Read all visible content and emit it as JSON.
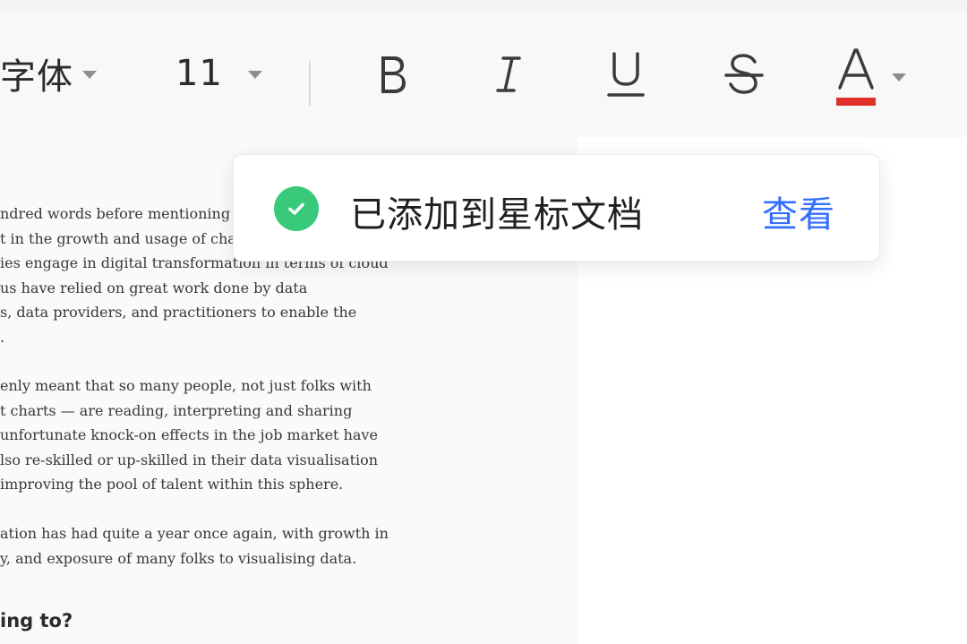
{
  "colors": {
    "accent": "#3370ff",
    "success": "#39c97a",
    "font_color_underline": "#e03128"
  },
  "toolbar": {
    "font_family": "字体",
    "font_size": "11",
    "bold_icon": "bold-icon",
    "italic_icon": "italic-icon",
    "underline_icon": "underline-icon",
    "strikethrough_icon": "strikethrough-icon",
    "font_color_icon": "font-color-icon"
  },
  "toast": {
    "icon": "check-circle-icon",
    "message": "已添加到星标文档",
    "action_label": "查看"
  },
  "document": {
    "paragraphs": [
      [
        "ndred words before mentioning C",
        "t in the growth and usage of chart",
        "ies engage in digital transformation in terms of cloud",
        "us have relied on great work done by data",
        "s, data providers, and practitioners to enable the",
        "."
      ],
      [
        "enly meant that so many people, not just folks with",
        "t charts — are reading, interpreting and sharing",
        "unfortunate knock-on effects in the job market have",
        "lso re-skilled or up-skilled in their data visualisation",
        "improving the pool of talent within this sphere."
      ],
      [
        "ation has had quite a year once again, with growth in",
        "y, and exposure of many folks to visualising data."
      ]
    ],
    "heading": "ing to?"
  }
}
